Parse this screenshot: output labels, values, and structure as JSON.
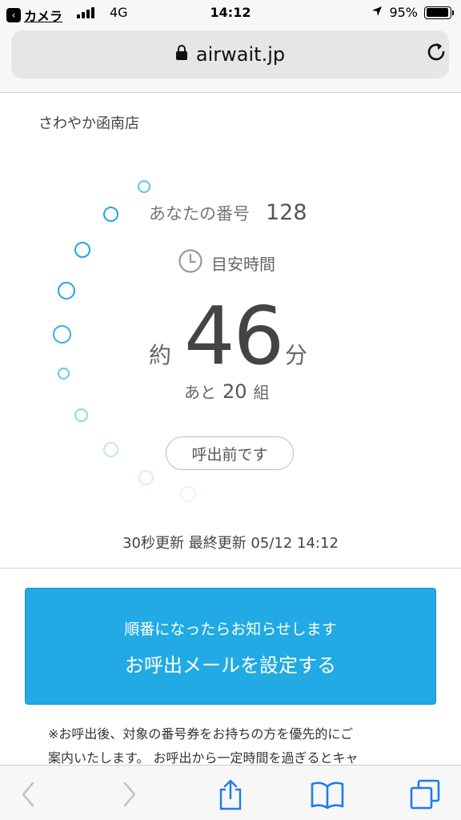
{
  "status_bar": {
    "back_app": "カメラ",
    "network": "4G",
    "time": "14:12",
    "battery": "95%",
    "battery_level": 0.95
  },
  "browser": {
    "url": "airwait.jp"
  },
  "store": {
    "name": "さわやか函南店"
  },
  "ticket": {
    "your_number_label": "あなたの番号",
    "your_number": "128",
    "estimate_label": "目安時間",
    "approx": "約",
    "minutes": "46",
    "minutes_unit": "分",
    "remaining_prefix": "あと",
    "remaining_groups": "20",
    "remaining_suffix": "組",
    "status": "呼出前です"
  },
  "update": {
    "text": "30秒更新 最終更新 05/12 14:12"
  },
  "notify": {
    "subtitle": "順番になったらお知らせします",
    "title": "お呼出メールを設定する",
    "color": "#21aae3"
  },
  "note": {
    "line1": "※お呼出後、対象の番号券をお持ちの方を優先的にご",
    "line2": "案内いたします。 お呼出から一定時間を過ぎるとキャ"
  },
  "toolbar": {
    "icons": [
      "back-icon",
      "forward-icon",
      "share-icon",
      "bookmarks-icon",
      "tabs-icon"
    ]
  }
}
